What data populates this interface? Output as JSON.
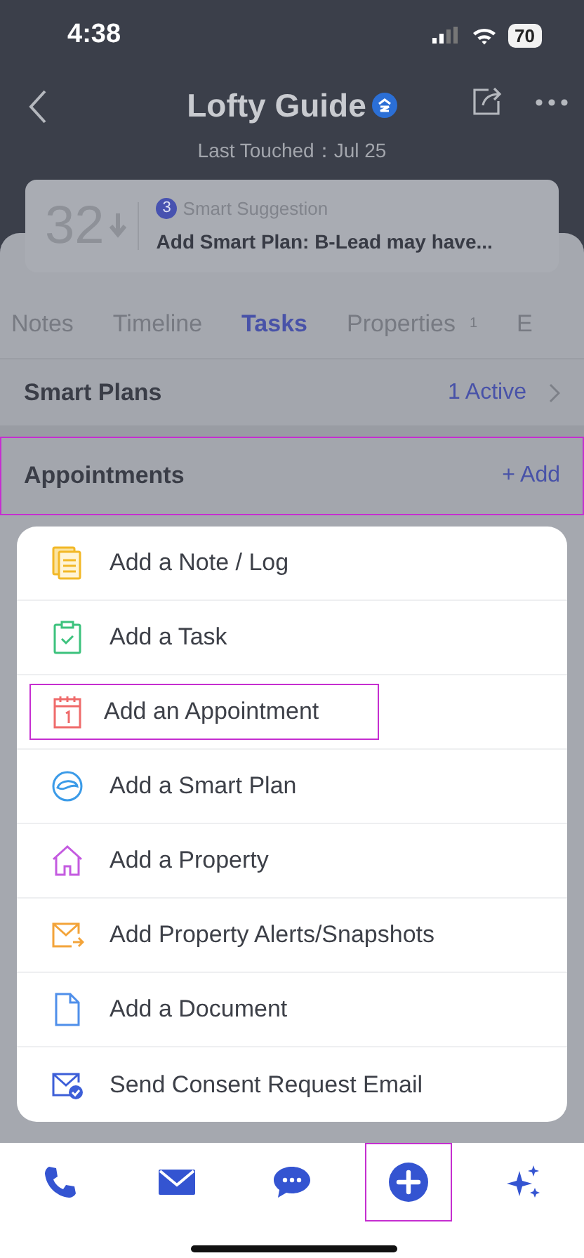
{
  "status_bar": {
    "time": "4:38",
    "battery": "70"
  },
  "header": {
    "title": "Lofty Guide",
    "subtitle": "Last Touched：Jul 25"
  },
  "suggestion": {
    "score": "32",
    "count": "3",
    "label": "Smart Suggestion",
    "text": "Add Smart Plan: B-Lead may have..."
  },
  "tabs": [
    {
      "label": "Notes",
      "selected": false
    },
    {
      "label": "Timeline",
      "selected": false
    },
    {
      "label": "Tasks",
      "selected": true
    },
    {
      "label": "Properties",
      "count": "1",
      "selected": false
    },
    {
      "label": "E",
      "selected": false
    }
  ],
  "smart_plans": {
    "title": "Smart Plans",
    "status": "1 Active"
  },
  "appointments": {
    "title": "Appointments",
    "action": "+ Add",
    "highlighted": true
  },
  "menu": [
    {
      "kind": "note",
      "label": "Add a Note / Log",
      "highlighted": false
    },
    {
      "kind": "task",
      "label": "Add a Task",
      "highlighted": false
    },
    {
      "kind": "calendar",
      "label": "Add an Appointment",
      "highlighted": true
    },
    {
      "kind": "plan",
      "label": "Add a Smart Plan",
      "highlighted": false
    },
    {
      "kind": "home",
      "label": "Add a Property",
      "highlighted": false
    },
    {
      "kind": "alert",
      "label": "Add Property Alerts/Snapshots",
      "highlighted": false
    },
    {
      "kind": "document",
      "label": "Add a Document",
      "highlighted": false
    },
    {
      "kind": "consent",
      "label": "Send Consent Request Email",
      "highlighted": false
    }
  ],
  "bottom_bar": [
    {
      "kind": "phone",
      "highlighted": false
    },
    {
      "kind": "mail",
      "highlighted": false
    },
    {
      "kind": "chat",
      "highlighted": false
    },
    {
      "kind": "add",
      "highlighted": true
    },
    {
      "kind": "sparkle",
      "highlighted": false
    }
  ]
}
